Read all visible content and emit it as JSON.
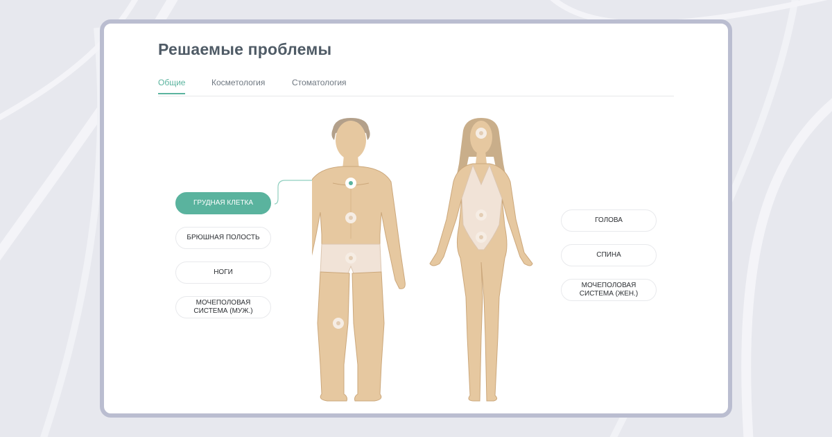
{
  "page": {
    "title": "Решаемые проблемы"
  },
  "tabs": [
    {
      "label": "Общие",
      "active": true
    },
    {
      "label": "Косметология",
      "active": false
    },
    {
      "label": "Стоматология",
      "active": false
    }
  ],
  "left_zones": [
    {
      "label": "Грудная клетка",
      "active": true
    },
    {
      "label": "Брюшная полость",
      "active": false
    },
    {
      "label": "Ноги",
      "active": false
    },
    {
      "label": "Мочеполовая\nсистема (муж.)",
      "active": false
    }
  ],
  "right_zones": [
    {
      "label": "Голова",
      "active": false
    },
    {
      "label": "Спина",
      "active": false
    },
    {
      "label": "Мочеполовая\nсистема (жен.)",
      "active": false
    }
  ],
  "colors": {
    "accent": "#5ab39e",
    "skin": "#e6c8a0",
    "card_border": "#babdd0",
    "background": "#e7e8ee"
  },
  "icons": {
    "marker": "hotspot-dot-icon"
  }
}
